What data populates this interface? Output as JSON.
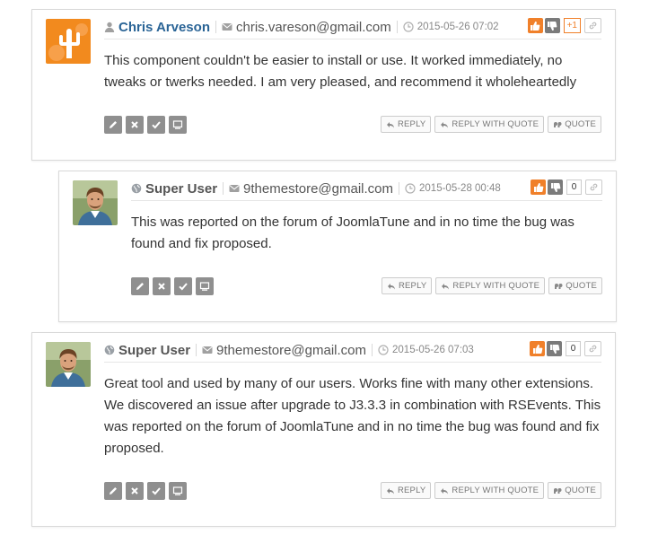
{
  "comments": [
    {
      "author": "Chris Arveson",
      "author_kind": "registered-user",
      "email": "chris.vareson@gmail.com",
      "date": "2015-05-26 07:02",
      "score": "+1",
      "avatar": "orange-cactus-logo",
      "text": "This component couldn't be easier to install or use. It worked immediately, no tweaks or twerks needed. I am very pleased, and recommend it wholeheartedly"
    },
    {
      "author": "Super User",
      "author_kind": "globe-user",
      "email": "9themestore@gmail.com",
      "date": "2015-05-28 00:48",
      "score": "0",
      "avatar": "man-photo",
      "text": "This was reported on the forum of JoomlaTune and in no time the bug was found and fix proposed."
    },
    {
      "author": "Super User",
      "author_kind": "globe-user",
      "email": "9themestore@gmail.com",
      "date": "2015-05-26 07:03",
      "score": "0",
      "avatar": "man-photo",
      "text": "Great tool and used by many of our users. Works fine with many other extensions. We discovered an issue after upgrade to J3.3.3 in combination with RSEvents. This was reported on the forum of JoomlaTune and in no time the bug was found and fix proposed."
    }
  ],
  "labels": {
    "reply": "REPLY",
    "reply_with_quote": "REPLY WITH QUOTE",
    "quote": "QUOTE"
  },
  "colors": {
    "vote_up": "#f0802a",
    "vote_down": "#7b7b7b",
    "author_link": "#2a6496",
    "tool_bg": "#8f8f8f"
  },
  "icons": {
    "user": "user-icon",
    "globe": "globe-icon",
    "email": "envelope-icon",
    "date": "clock-icon",
    "vote_up": "thumbs-up-icon",
    "vote_down": "thumbs-down-icon",
    "permalink": "link-icon",
    "edit": "pencil-icon",
    "delete": "x-icon",
    "publish": "check-icon",
    "ip": "monitor-icon",
    "reply": "reply-arrow-icon",
    "quote": "quote-icon"
  }
}
